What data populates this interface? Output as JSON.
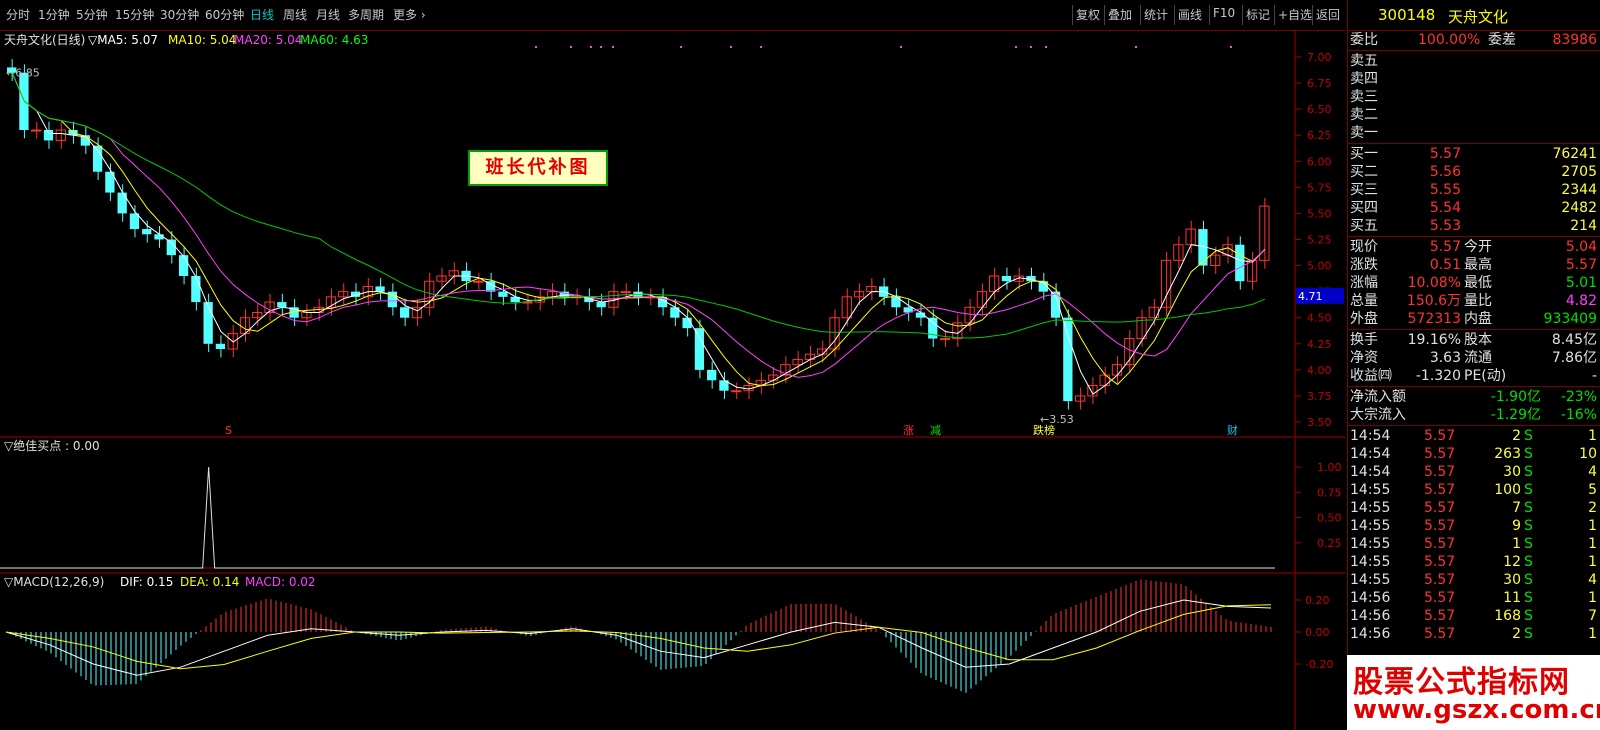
{
  "toolbar": {
    "periods": [
      "分时",
      "1分钟",
      "5分钟",
      "15分钟",
      "30分钟",
      "60分钟",
      "日线",
      "周线",
      "月线",
      "多周期",
      "更多 ›"
    ],
    "active": "日线",
    "right_buttons": [
      "复权",
      "叠加",
      "统计",
      "画线",
      "F10",
      "标记",
      "+自选",
      "返回"
    ]
  },
  "header": {
    "code": "300148",
    "name": "天舟文化"
  },
  "main_chart": {
    "title": "天舟文化(日线)",
    "indicators": [
      {
        "label": "MA5: 5.07",
        "color": "#ffffff"
      },
      {
        "label": "MA10: 5.04",
        "color": "#ffff00"
      },
      {
        "label": "MA20: 5.04",
        "color": "#ff40ff"
      },
      {
        "label": "MA60: 4.63",
        "color": "#00ff00"
      }
    ],
    "y_ticks": [
      "7.00",
      "6.75",
      "6.50",
      "6.25",
      "6.00",
      "5.75",
      "5.50",
      "5.25",
      "5.00",
      "4.75",
      "4.50",
      "4.25",
      "4.00",
      "3.75",
      "3.50"
    ],
    "price_tag": "4.71",
    "high_label": "6.85",
    "low_label": "3.53",
    "stamp_text": "班长代补图",
    "event_marks": [
      "S",
      "涨",
      "减",
      "跌榜",
      "财"
    ]
  },
  "best_buy": {
    "title": "▽绝佳买点 : 0.00",
    "y_ticks": [
      "1.00",
      "0.75",
      "0.50",
      "0.25"
    ]
  },
  "macd": {
    "title": "▽MACD(12,26,9)",
    "dif": "DIF: 0.15",
    "dea": "DEA: 0.14",
    "macd": "MACD: 0.02",
    "y_ticks": [
      "0.20",
      "0.00",
      "-0.20"
    ]
  },
  "quote": {
    "weibi_label": "委比",
    "weibi": "100.00%",
    "weicha_label": "委差",
    "weicha": "83986",
    "sells": [
      "卖五",
      "卖四",
      "卖三",
      "卖二",
      "卖一"
    ],
    "buys": [
      {
        "label": "买一",
        "price": "5.57",
        "vol": "76241"
      },
      {
        "label": "买二",
        "price": "5.56",
        "vol": "2705"
      },
      {
        "label": "买三",
        "price": "5.55",
        "vol": "2344"
      },
      {
        "label": "买四",
        "price": "5.54",
        "vol": "2482"
      },
      {
        "label": "买五",
        "price": "5.53",
        "vol": "214"
      }
    ],
    "stats": [
      {
        "l1": "现价",
        "v1": "5.57",
        "l2": "今开",
        "v2": "5.04"
      },
      {
        "l1": "涨跌",
        "v1": "0.51",
        "l2": "最高",
        "v2": "5.57"
      },
      {
        "l1": "涨幅",
        "v1": "10.08%",
        "l2": "最低",
        "v2": "5.01"
      },
      {
        "l1": "总量",
        "v1": "150.6万",
        "l2": "量比",
        "v2": "4.82"
      },
      {
        "l1": "外盘",
        "v1": "572313",
        "l2": "内盘",
        "v2": "933409"
      }
    ],
    "fund": [
      {
        "l1": "换手",
        "v1": "19.16%",
        "l2": "股本",
        "v2": "8.45亿"
      },
      {
        "l1": "净资",
        "v1": "3.63",
        "l2": "流通",
        "v2": "7.86亿"
      },
      {
        "l1": "收益㈣",
        "v1": "-1.320",
        "l2": "PE(动)",
        "v2": "-"
      }
    ],
    "flows": [
      {
        "label": "净流入额",
        "v": "-1.90亿",
        "p": "-23%"
      },
      {
        "label": "大宗流入",
        "v": "-1.29亿",
        "p": "-16%"
      }
    ],
    "ticks": [
      {
        "t": "14:54",
        "p": "5.57",
        "v": "2",
        "s": "S",
        "n": "1"
      },
      {
        "t": "14:54",
        "p": "5.57",
        "v": "263",
        "s": "S",
        "n": "10"
      },
      {
        "t": "14:54",
        "p": "5.57",
        "v": "30",
        "s": "S",
        "n": "4"
      },
      {
        "t": "14:55",
        "p": "5.57",
        "v": "100",
        "s": "S",
        "n": "5"
      },
      {
        "t": "14:55",
        "p": "5.57",
        "v": "7",
        "s": "S",
        "n": "2"
      },
      {
        "t": "14:55",
        "p": "5.57",
        "v": "9",
        "s": "S",
        "n": "1"
      },
      {
        "t": "14:55",
        "p": "5.57",
        "v": "1",
        "s": "S",
        "n": "1"
      },
      {
        "t": "14:55",
        "p": "5.57",
        "v": "12",
        "s": "S",
        "n": "1"
      },
      {
        "t": "14:55",
        "p": "5.57",
        "v": "30",
        "s": "S",
        "n": "4"
      },
      {
        "t": "14:56",
        "p": "5.57",
        "v": "11",
        "s": "S",
        "n": "1"
      },
      {
        "t": "14:56",
        "p": "5.57",
        "v": "168",
        "s": "S",
        "n": "7"
      },
      {
        "t": "14:56",
        "p": "5.57",
        "v": "2",
        "s": "S",
        "n": "1"
      }
    ]
  },
  "watermark": {
    "line1": "股票公式指标网",
    "line2": "www.gszx.com.cn"
  },
  "chart_data": {
    "type": "candlestick",
    "series_ma": [
      "MA5",
      "MA10",
      "MA20",
      "MA60"
    ],
    "closes": [
      6.85,
      6.3,
      6.3,
      6.2,
      6.3,
      6.25,
      6.15,
      5.9,
      5.7,
      5.5,
      5.35,
      5.3,
      5.25,
      5.1,
      4.9,
      4.65,
      4.25,
      4.2,
      4.35,
      4.5,
      4.55,
      4.65,
      4.6,
      4.5,
      4.55,
      4.6,
      4.7,
      4.75,
      4.7,
      4.8,
      4.75,
      4.6,
      4.5,
      4.6,
      4.85,
      4.9,
      4.95,
      4.85,
      4.85,
      4.75,
      4.7,
      4.65,
      4.65,
      4.7,
      4.75,
      4.7,
      4.7,
      4.65,
      4.6,
      4.75,
      4.75,
      4.7,
      4.7,
      4.6,
      4.5,
      4.4,
      4.0,
      3.9,
      3.8,
      3.8,
      3.85,
      3.9,
      3.95,
      4.05,
      4.1,
      4.15,
      4.2,
      4.5,
      4.7,
      4.75,
      4.8,
      4.7,
      4.6,
      4.55,
      4.5,
      4.3,
      4.3,
      4.45,
      4.6,
      4.75,
      4.9,
      4.85,
      4.9,
      4.85,
      4.75,
      4.5,
      3.7,
      3.75,
      3.85,
      3.95,
      4.05,
      4.3,
      4.5,
      4.6,
      5.05,
      5.2,
      5.35,
      5.0,
      5.1,
      5.2,
      4.85,
      5.05,
      5.57
    ],
    "macd_dif": [
      0.0,
      -0.08,
      -0.2,
      -0.27,
      -0.22,
      -0.12,
      -0.02,
      0.02,
      0.0,
      -0.02,
      0.0,
      0.01,
      -0.01,
      0.02,
      -0.02,
      -0.12,
      -0.16,
      -0.08,
      0.0,
      0.06,
      0.03,
      -0.1,
      -0.22,
      -0.2,
      -0.1,
      0.0,
      0.13,
      0.2,
      0.16,
      0.15
    ],
    "best_buy_spike_index": 16,
    "y_range": [
      3.5,
      7.0
    ]
  }
}
